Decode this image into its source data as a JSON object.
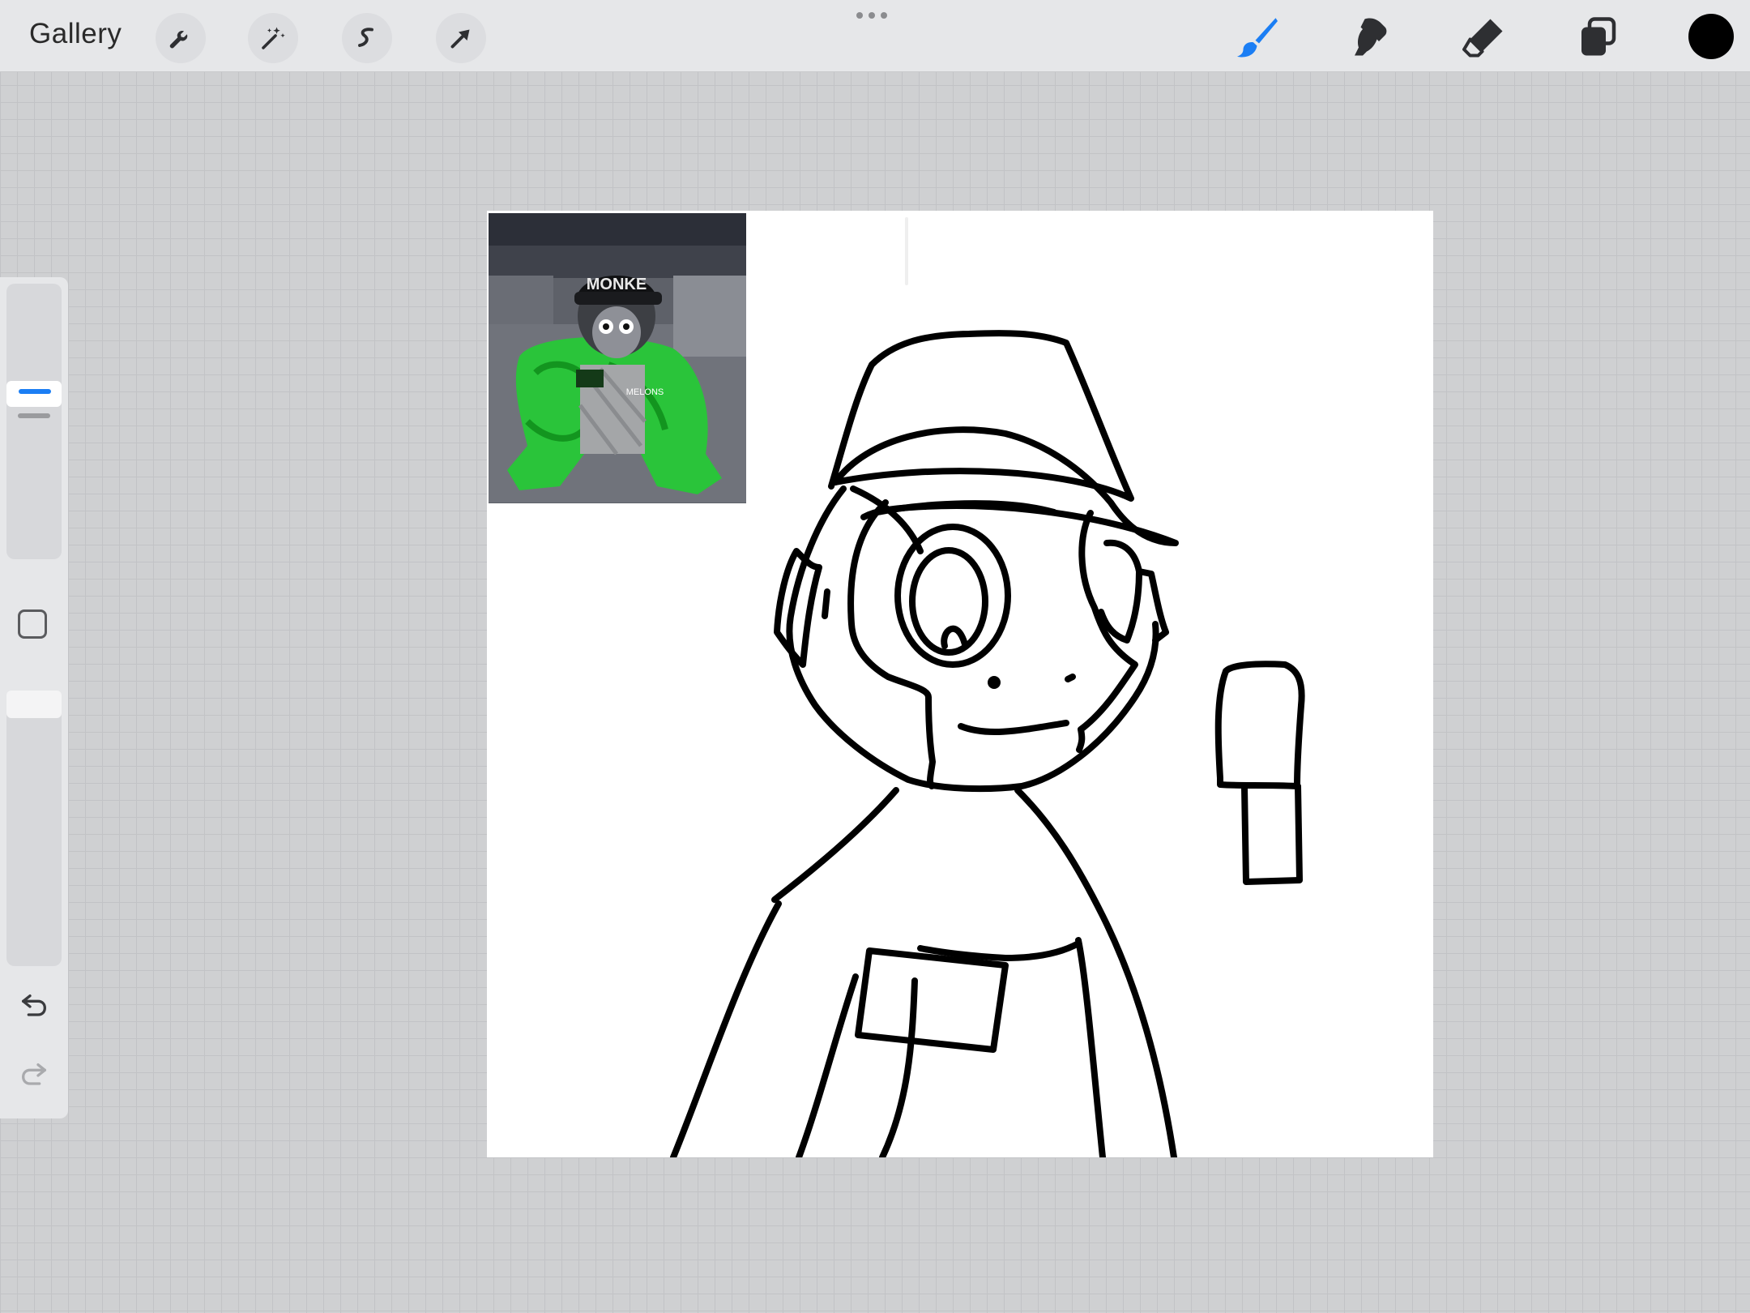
{
  "topbar": {
    "gallery_label": "Gallery",
    "left_tools": [
      "wrench-icon",
      "magic-wand-icon",
      "selection-icon",
      "transform-arrow-icon"
    ],
    "right_tools": [
      "brush-icon",
      "smudge-icon",
      "eraser-icon",
      "layers-icon"
    ],
    "active_tool": "brush",
    "accent_color": "#1b7ef4",
    "current_color": "#000000"
  },
  "sidebar": {
    "brush_size_level": 0.35,
    "brush_opacity_level": 0.0,
    "icons": [
      "modify-square-icon",
      "undo-icon",
      "redo-icon"
    ]
  },
  "reference_image": {
    "cap_text": "MONKE",
    "shirt_text": "MELONS"
  },
  "canvas": {
    "background_color": "#ffffff",
    "stroke_color": "#000000"
  }
}
